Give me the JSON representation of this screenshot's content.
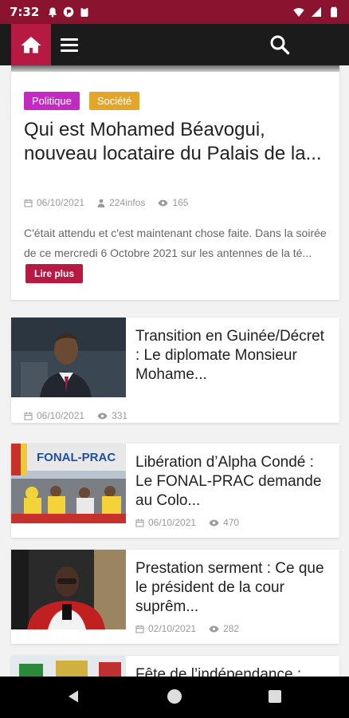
{
  "status_bar": {
    "time": "7:32",
    "left_icons": [
      "notification-bell-icon",
      "app-notification-icon",
      "clipboard-icon"
    ],
    "right_icons": [
      "wifi-icon",
      "cellular-signal-icon",
      "battery-icon"
    ]
  },
  "nav": {
    "icons": [
      "home-icon",
      "menu-icon",
      "search-icon"
    ],
    "accent_color": "#b61a43",
    "bar_color": "#1b1b1b"
  },
  "featured": {
    "tags": [
      "Politique",
      "Société"
    ],
    "title": "Qui est Mohamed Béavogui, nouveau locataire du Palais de la...",
    "date": "06/10/2021",
    "author": "224infos",
    "views": "165",
    "excerpt": "C'était attendu et c'est maintenant chose faite. Dans la soirée de ce mercredi 6 Octobre 2021 sur les antennes de la té...",
    "read_more": "Lire plus"
  },
  "posts": [
    {
      "title": "Transition en Guinée/Décret : Le diplomate Monsieur Mohame...",
      "date": "06/10/2021",
      "views": "331"
    },
    {
      "title": "Libération d’Alpha Condé : Le FONAL-PRAC demande au Colo...",
      "date": "06/10/2021",
      "views": "470"
    },
    {
      "title": "Prestation serment : Ce que le président de la cour suprêm...",
      "date": "02/10/2021",
      "views": "282"
    },
    {
      "title": "Fête de l’indépendance :",
      "date": "",
      "views": ""
    }
  ],
  "thumbnail_texts": {
    "fonal_banner": "FONAL-PRAC"
  },
  "colors": {
    "status_bar": "#8a1430",
    "tag_politique": "#c32ac2",
    "tag_societe": "#e2a72a",
    "scroll_top": "#e8859c"
  }
}
